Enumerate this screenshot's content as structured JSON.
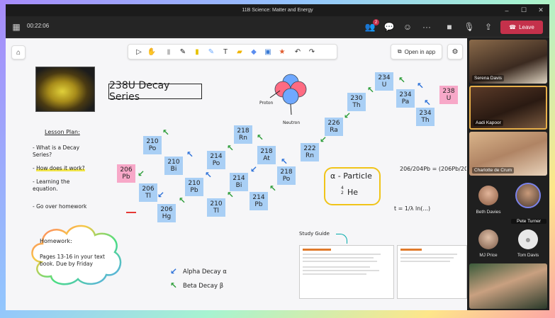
{
  "window": {
    "title": "11B Science: Matter and Energy"
  },
  "toolbar": {
    "timer": "00:22:06",
    "notification_count": "2",
    "leave_label": "Leave"
  },
  "board": {
    "open_in_app": "Open in app",
    "title": "238U Decay Series",
    "lesson_plan": {
      "heading": "Lesson Plan:",
      "items": [
        "What is a Decay Series?",
        "How does it work?",
        "Learning the equation.",
        "Go over homework"
      ]
    },
    "homework": {
      "heading": "Homework:",
      "body": "Pages 13-16 in your text book. Due by Friday"
    },
    "atom": {
      "proton_label": "Proton",
      "neutron_label": "Neutron"
    },
    "particle": {
      "title": "α - Particle",
      "top": "4",
      "bottom": "2",
      "symbol": "He"
    },
    "legend": {
      "alpha": "Alpha Decay α",
      "beta": "Beta Decay β"
    },
    "study_guide": "Study Guide",
    "equations": {
      "ratio": "206/204Pb = (206Pb/204Pb)t + ...",
      "time": "t = 1/λ ln(...)"
    },
    "stickies": {
      "u238": "238\nU",
      "u234": "234\nU",
      "th234": "234\nTh",
      "pa234": "234\nPa",
      "th230": "230\nTh",
      "ra226": "226\nRa",
      "rn222": "222\nRn",
      "po218": "218\nPo",
      "at218": "218\nAt",
      "rn218": "218\nRn",
      "po214": "214\nPo",
      "bi214": "214\nBi",
      "pb214": "214\nPb",
      "po210": "210\nPo",
      "bi210": "210\nBi",
      "pb210": "210\nPb",
      "ti210": "210\nTl",
      "po210b": "210\nPo",
      "ti206": "206\nTl",
      "hg206": "206\nHg",
      "pb206": "206\nPb"
    }
  },
  "participants": [
    {
      "name": "Serena Davis"
    },
    {
      "name": "Aadi Kapoor"
    },
    {
      "name": "Charlotte de Crum"
    },
    {
      "name": "Beth Davies"
    },
    {
      "name": "Pete Turner"
    },
    {
      "name": "MJ Price"
    },
    {
      "name": "Tom Davis"
    }
  ],
  "colors": {
    "leave": "#c4314b",
    "sticky_blue": "#a9cff5",
    "sticky_pink": "#f7a8c8",
    "arrow_green": "#2e9e3a",
    "speaking_border": "#e8b04a"
  }
}
